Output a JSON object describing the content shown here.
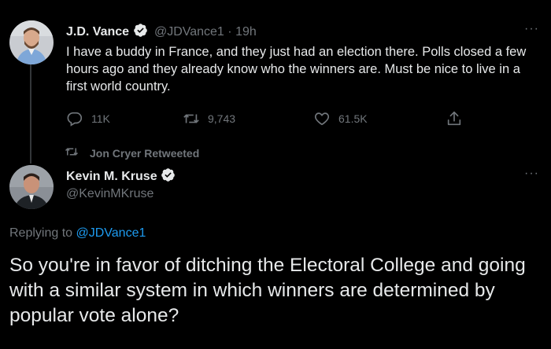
{
  "tweet1": {
    "name": "J.D. Vance",
    "handle": "@JDVance1",
    "time_sep": "·",
    "time": "19h",
    "more": "···",
    "text": "I have a buddy in France, and they just had an election there. Polls closed a few hours ago and they already know who the winners are. Must be nice to live in a first world country.",
    "actions": {
      "replies": "11K",
      "retweets": "9,743",
      "likes": "61.5K"
    }
  },
  "retweet_banner": {
    "text": "Jon Cryer Retweeted"
  },
  "tweet2": {
    "name": "Kevin M. Kruse",
    "handle": "@KevinMKruse",
    "more": "···",
    "replying_prefix": "Replying to",
    "replying_handle": "@JDVance1",
    "text": "So you're in favor of ditching the Electoral College and going with a similar system in which winners are determined by popular vote alone?"
  },
  "colors": {
    "background": "#000000",
    "text": "#e7e9ea",
    "muted": "#71767b",
    "accent": "#1d9bf0"
  },
  "icons": [
    "reply-icon",
    "retweet-icon",
    "like-icon",
    "share-icon",
    "verified-icon",
    "more-icon"
  ]
}
